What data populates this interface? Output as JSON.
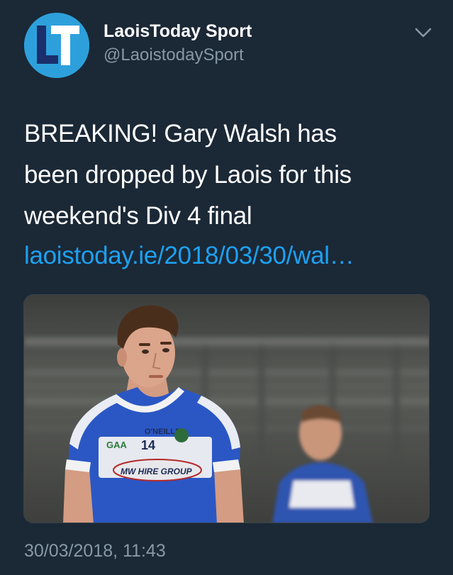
{
  "account": {
    "display_name": "LaoisToday Sport",
    "handle": "@LaoistodaySport",
    "avatar_logo_text": "LT"
  },
  "tweet": {
    "text_lines": [
      "BREAKING! Gary Walsh has",
      "been dropped by Laois for this",
      "weekend's Div 4 final"
    ],
    "link": "laoistoday.ie/2018/03/30/wal…",
    "timestamp": "30/03/2018, 11:43"
  },
  "media": {
    "description_icon": "photo-of-football-player",
    "jersey_number": "14",
    "jersey_brand": "O'NEILLS",
    "jersey_crest": "GAA",
    "jersey_sponsor": "MW HIRE GROUP"
  },
  "icons": {
    "menu": "chevron-down-icon"
  },
  "colors": {
    "background": "#1b2836",
    "link": "#1da1f2",
    "secondary_text": "#8899a6",
    "avatar": "#2da0dc"
  }
}
